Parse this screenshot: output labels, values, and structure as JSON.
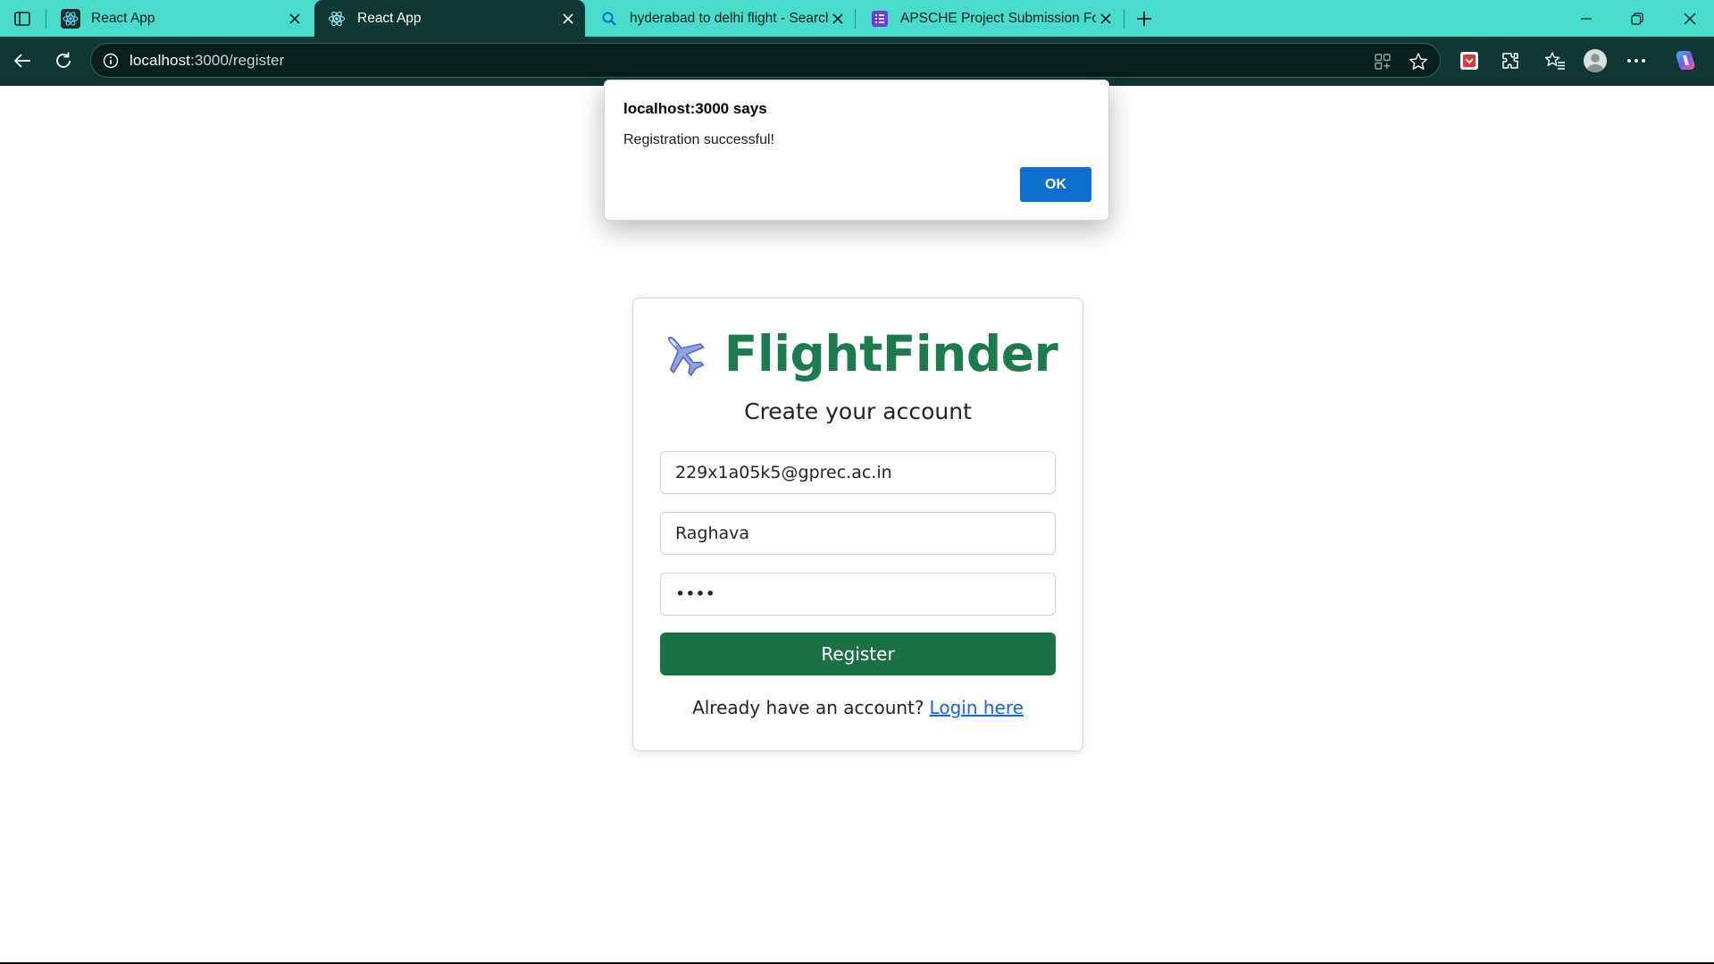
{
  "browser": {
    "tabs": [
      {
        "title": "React App",
        "icon": "react-icon",
        "active": false
      },
      {
        "title": "React App",
        "icon": "react-icon",
        "active": true
      },
      {
        "title": "hyderabad to delhi flight - Search",
        "icon": "search-icon",
        "active": false
      },
      {
        "title": "APSCHE Project Submission Form",
        "icon": "form-icon",
        "active": false
      }
    ],
    "url_host": "localhost",
    "url_path": ":3000/register"
  },
  "alert": {
    "title": "localhost:3000 says",
    "message": "Registration successful!",
    "ok_label": "OK"
  },
  "form": {
    "brand_icon": "airplane-icon",
    "brand": "FlightFinder",
    "subtitle": "Create your account",
    "email_value": "229x1a05k5@gprec.ac.in",
    "name_value": "Raghava",
    "password_value": "••••",
    "register_label": "Register",
    "footer_text": "Already have an account?",
    "login_link": "Login here"
  },
  "colors": {
    "tabstrip": "#49dccb",
    "toolbar": "#0f3733",
    "brand_green": "#1c7a4c",
    "register_button": "#197145",
    "ok_button": "#0c6fd1",
    "link": "#1e63d6"
  }
}
